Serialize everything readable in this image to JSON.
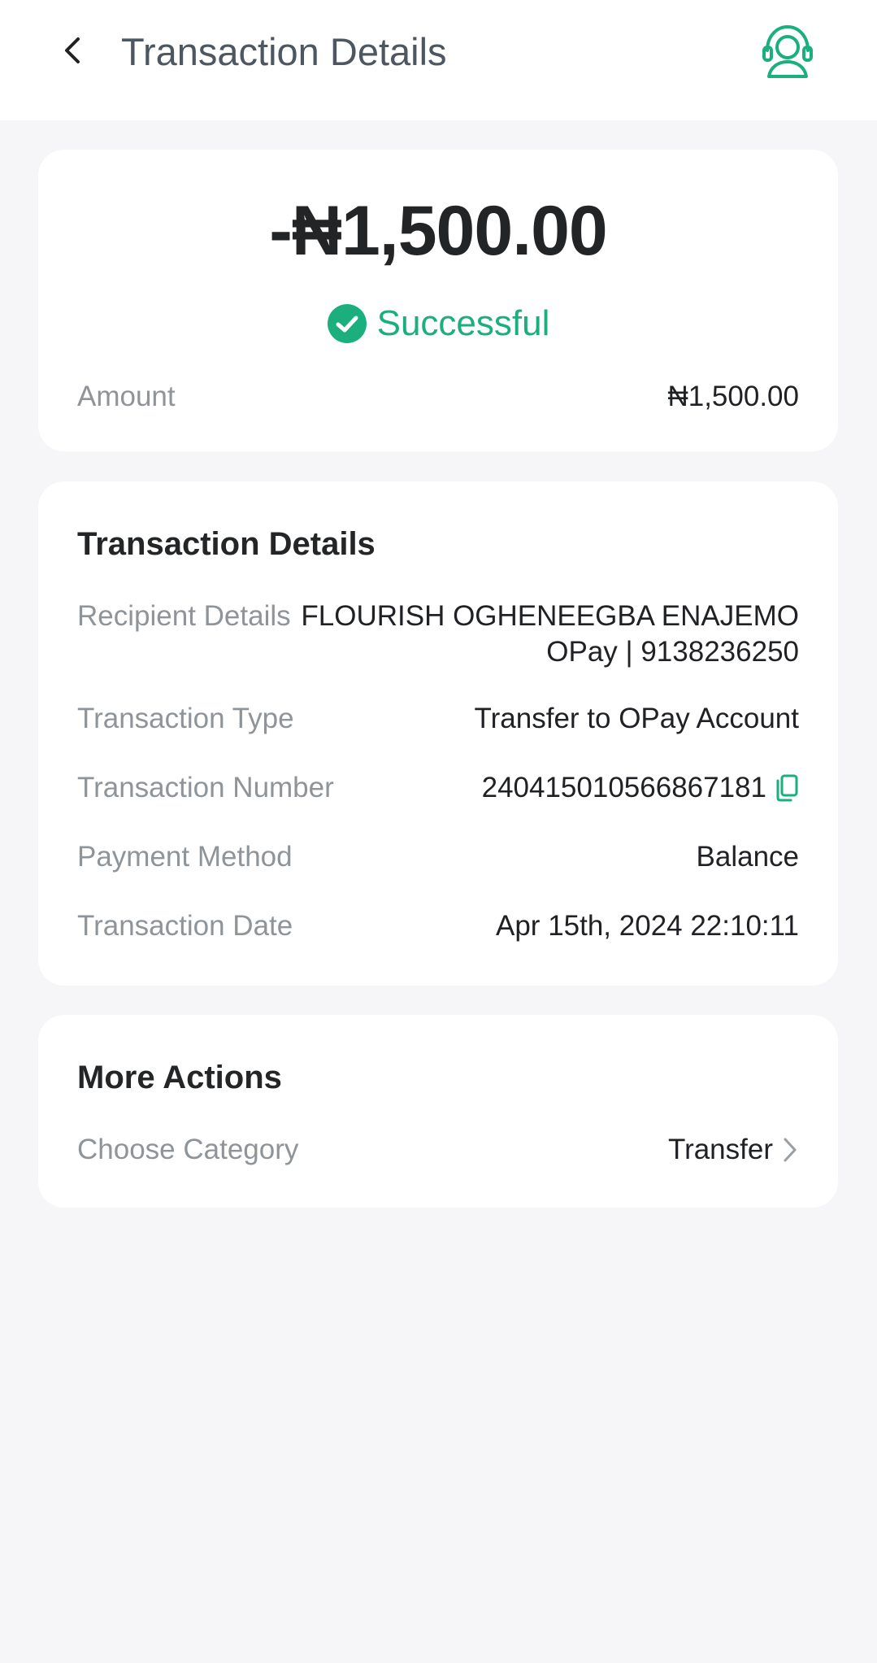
{
  "header": {
    "title": "Transaction Details",
    "back_icon": "chevron-left-icon",
    "support_icon": "headset-support-icon"
  },
  "summary": {
    "big_amount": "-₦1,500.00",
    "status": "Successful",
    "status_icon": "check-circle-icon",
    "amount_label": "Amount",
    "amount_value": "₦1,500.00"
  },
  "details": {
    "title": "Transaction Details",
    "recipient_label": "Recipient Details",
    "recipient_name": "FLOURISH OGHENEEGBA ENAJEMO",
    "recipient_account": "OPay | 9138236250",
    "type_label": "Transaction Type",
    "type_value": "Transfer to OPay Account",
    "number_label": "Transaction Number",
    "number_value": "240415010566867181",
    "copy_icon": "copy-icon",
    "method_label": "Payment Method",
    "method_value": "Balance",
    "date_label": "Transaction Date",
    "date_value": "Apr 15th, 2024 22:10:11"
  },
  "more": {
    "title": "More Actions",
    "category_label": "Choose Category",
    "category_value": "Transfer",
    "chevron_icon": "chevron-right-icon"
  },
  "colors": {
    "accent": "#1aaf7c",
    "background": "#f6f6f8",
    "card": "#ffffff",
    "text_primary": "#1f2124",
    "text_secondary": "#8f9499"
  }
}
